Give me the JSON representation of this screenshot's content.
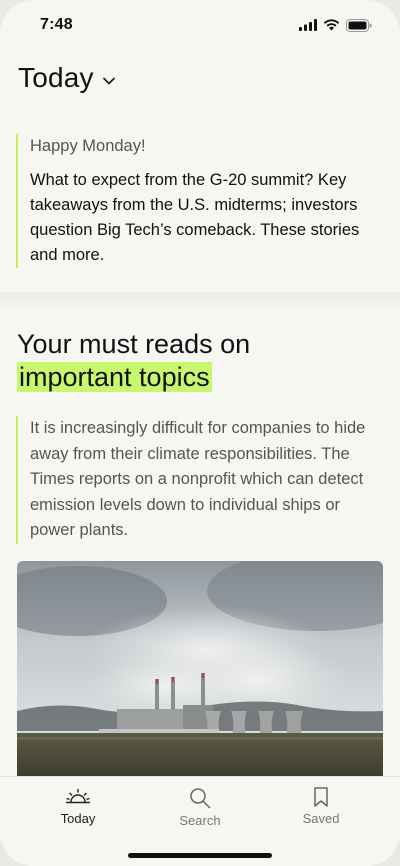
{
  "status_bar": {
    "time": "7:48",
    "icons": [
      "cellular-signal-icon",
      "wifi-icon",
      "battery-icon"
    ]
  },
  "header": {
    "title": "Today",
    "dropdown_icon": "chevron-down-icon"
  },
  "intro": {
    "greeting": "Happy Monday!",
    "summary": "What to expect from the G-20 summit? Key takeaways from the U.S. midterms; investors question Big Tech’s comeback. These stories and more."
  },
  "section": {
    "title_part1": "Your must reads on",
    "title_highlight": "important topics",
    "quote": "It is increasingly difficult for companies to hide away from their climate responsibilities. The Times reports on a nonprofit which can detect emission levels down to individual ships or power plants."
  },
  "tabbar": {
    "tabs": [
      {
        "label": "Today",
        "icon": "sunrise-icon",
        "active": true
      },
      {
        "label": "Search",
        "icon": "search-icon",
        "active": false
      },
      {
        "label": "Saved",
        "icon": "bookmark-icon",
        "active": false
      }
    ]
  },
  "colors": {
    "accent": "#c9f76b",
    "background": "#f6f6f3"
  }
}
